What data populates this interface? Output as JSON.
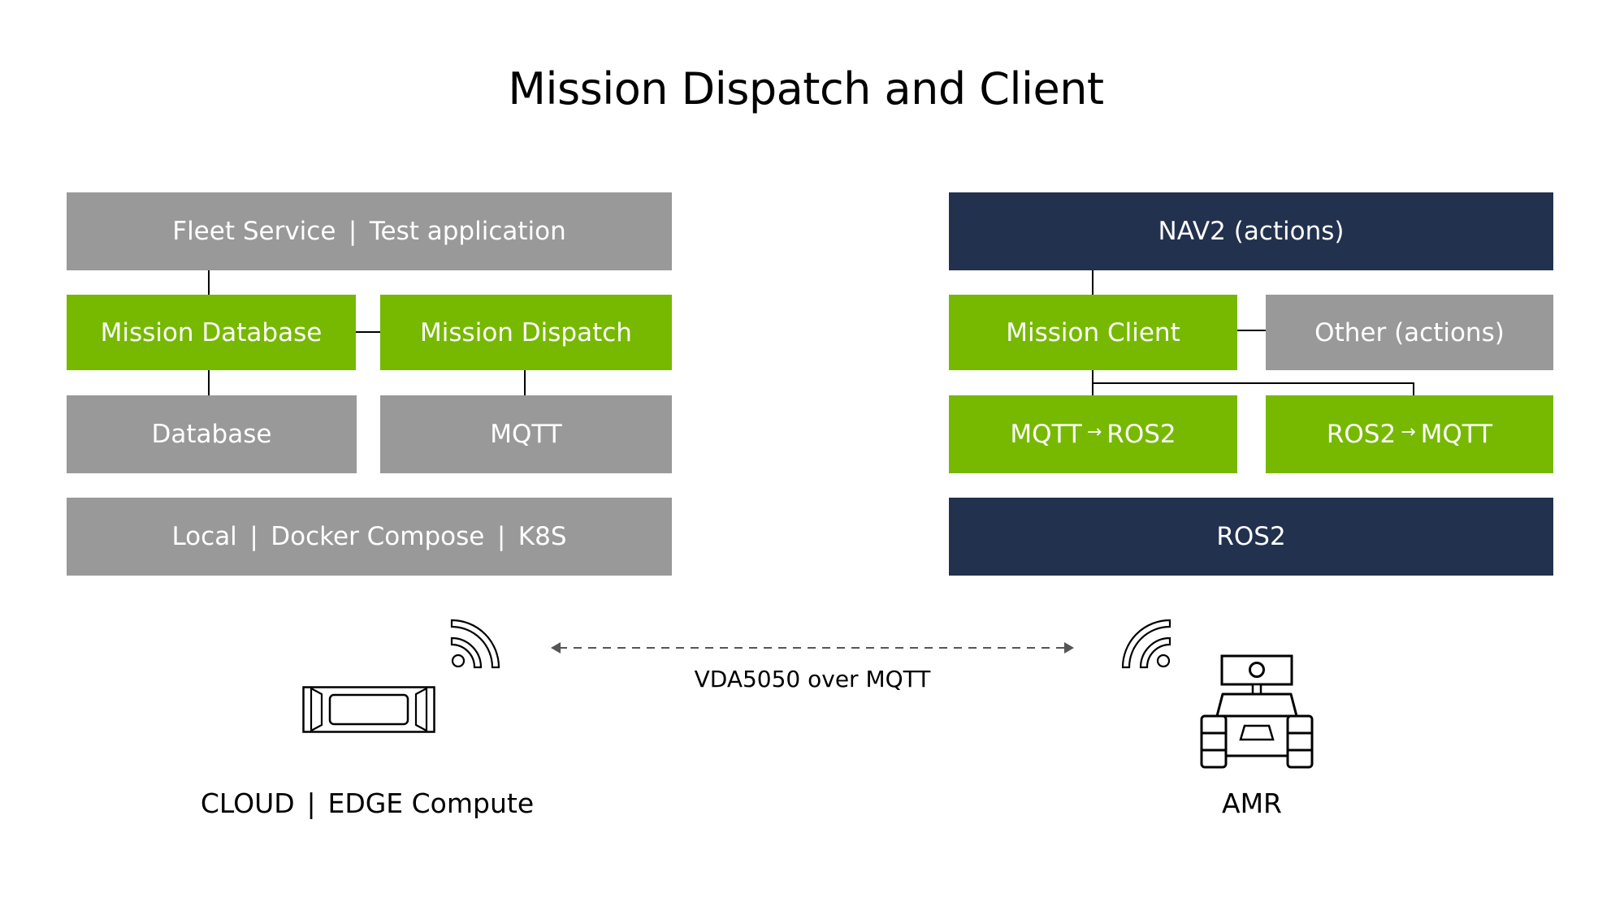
{
  "title": "Mission Dispatch and Client",
  "colors": {
    "green": "#76b900",
    "gray": "#999999",
    "navy": "#22314e",
    "connector": "#000000",
    "arrow": "#555555"
  },
  "left_stack": {
    "top": {
      "parts": [
        "Fleet Service",
        "Test application"
      ],
      "color": "gray"
    },
    "mission_database": {
      "label": "Mission Database",
      "color": "green"
    },
    "mission_dispatch": {
      "label": "Mission Dispatch",
      "color": "green"
    },
    "database": {
      "label": "Database",
      "color": "gray"
    },
    "mqtt": {
      "label": "MQTT",
      "color": "gray"
    },
    "deploy": {
      "parts": [
        "Local",
        "Docker Compose",
        "K8S"
      ],
      "color": "gray"
    }
  },
  "right_stack": {
    "nav2": {
      "bold": "NAV2",
      "light": "(actions)",
      "color": "navy"
    },
    "mission_client": {
      "label": "Mission Client",
      "color": "green"
    },
    "other": {
      "bold": "Other",
      "light": "(actions)",
      "color": "gray"
    },
    "mqtt_to_ros2": {
      "from": "MQTT",
      "arrow": "→",
      "to": "ROS2",
      "color": "green"
    },
    "ros2_to_mqtt": {
      "from": "ROS2",
      "arrow": "→",
      "to": "MQTT",
      "color": "green"
    },
    "ros2": {
      "label": "ROS2",
      "color": "navy"
    }
  },
  "link": {
    "label": "VDA5050 over MQTT",
    "style": "dashed bidirectional arrow"
  },
  "nodes": {
    "left": {
      "parts": [
        "CLOUD",
        "EDGE Compute"
      ],
      "icon": "edge-compute-device-icon",
      "signal_icon": "wireless-signal-icon"
    },
    "right": {
      "label": "AMR",
      "icon": "robot-icon",
      "signal_icon": "wireless-signal-icon"
    }
  },
  "separator": "|"
}
